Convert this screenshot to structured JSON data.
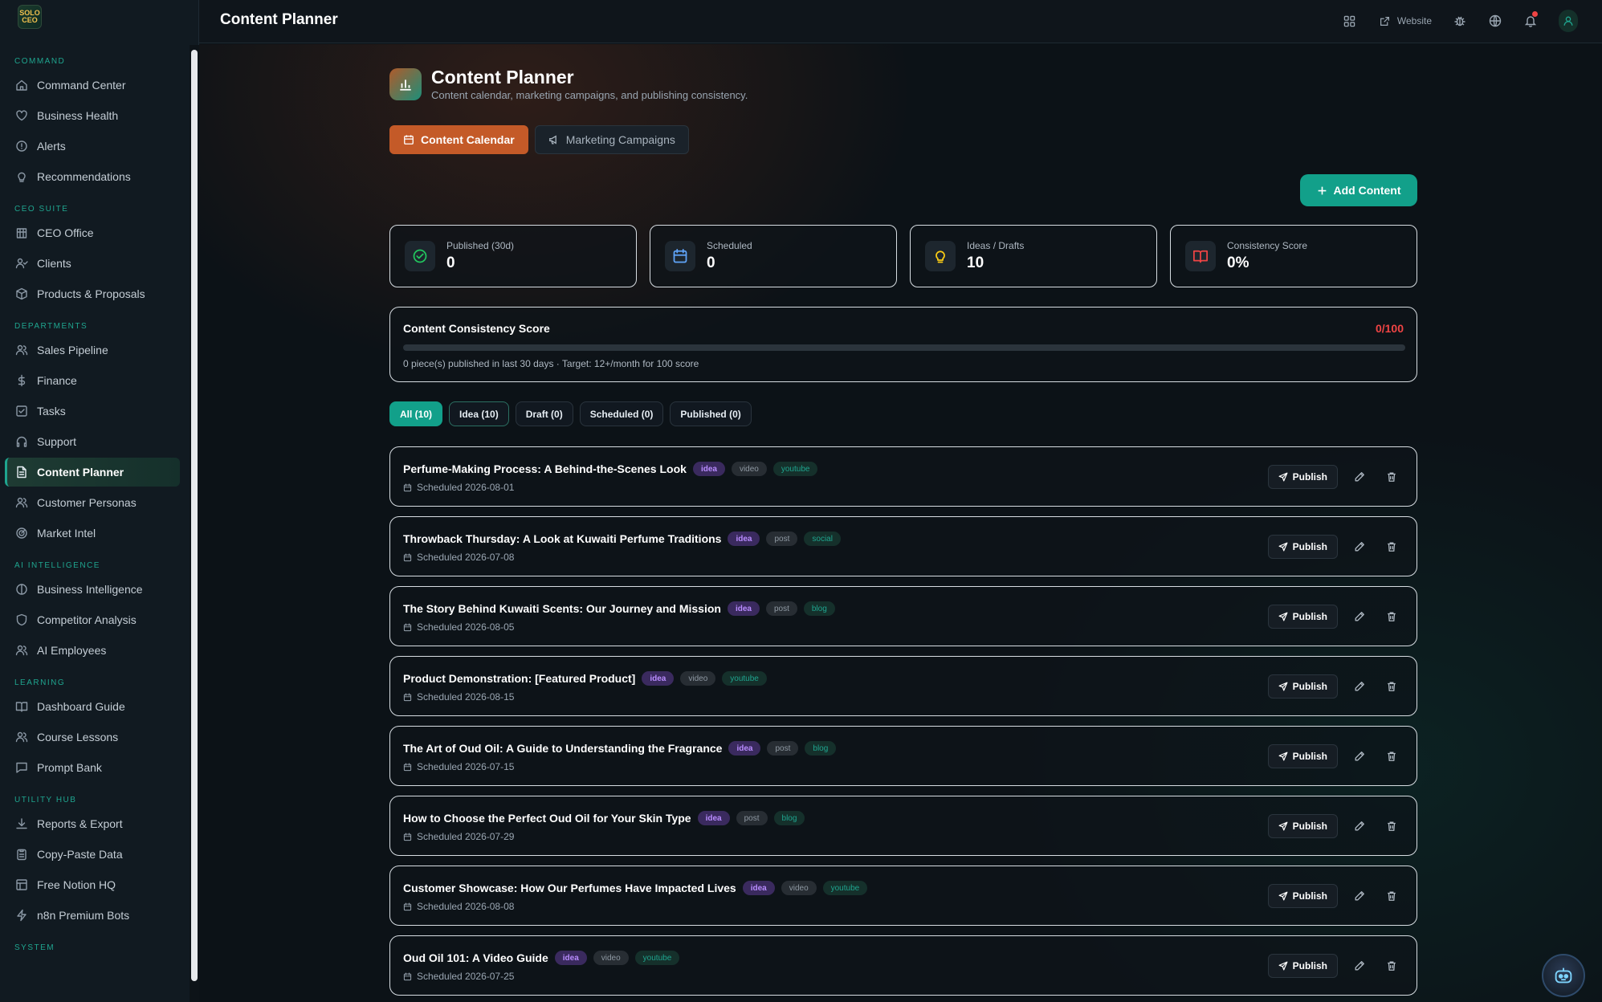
{
  "app": {
    "logo_text": "SOLO CEO",
    "topbar_title": "Content Planner"
  },
  "topbar": {
    "website_label": "Website"
  },
  "sidebar": {
    "sections": [
      {
        "label": "COMMAND",
        "items": [
          {
            "label": "Command Center",
            "icon": "home-icon"
          },
          {
            "label": "Business Health",
            "icon": "heart-icon"
          },
          {
            "label": "Alerts",
            "icon": "alert-circle-icon"
          },
          {
            "label": "Recommendations",
            "icon": "lightbulb-icon"
          }
        ]
      },
      {
        "label": "CEO SUITE",
        "items": [
          {
            "label": "CEO Office",
            "icon": "building-icon"
          },
          {
            "label": "Clients",
            "icon": "user-check-icon"
          },
          {
            "label": "Products & Proposals",
            "icon": "package-icon"
          }
        ]
      },
      {
        "label": "DEPARTMENTS",
        "items": [
          {
            "label": "Sales Pipeline",
            "icon": "users-icon"
          },
          {
            "label": "Finance",
            "icon": "dollar-icon"
          },
          {
            "label": "Tasks",
            "icon": "checkbox-icon"
          },
          {
            "label": "Support",
            "icon": "headphones-icon"
          },
          {
            "label": "Content Planner",
            "icon": "file-text-icon",
            "active": true
          },
          {
            "label": "Customer Personas",
            "icon": "users-icon"
          },
          {
            "label": "Market Intel",
            "icon": "radar-icon"
          }
        ]
      },
      {
        "label": "AI INTELLIGENCE",
        "items": [
          {
            "label": "Business Intelligence",
            "icon": "brain-icon"
          },
          {
            "label": "Competitor Analysis",
            "icon": "shield-icon"
          },
          {
            "label": "AI Employees",
            "icon": "users-icon"
          }
        ]
      },
      {
        "label": "LEARNING",
        "items": [
          {
            "label": "Dashboard Guide",
            "icon": "book-icon"
          },
          {
            "label": "Course Lessons",
            "icon": "users-icon"
          },
          {
            "label": "Prompt Bank",
            "icon": "message-icon"
          }
        ]
      },
      {
        "label": "UTILITY HUB",
        "items": [
          {
            "label": "Reports & Export",
            "icon": "download-icon"
          },
          {
            "label": "Copy-Paste Data",
            "icon": "clipboard-icon"
          },
          {
            "label": "Free Notion HQ",
            "icon": "layout-icon"
          },
          {
            "label": "n8n Premium Bots",
            "icon": "zap-icon"
          }
        ]
      },
      {
        "label": "SYSTEM",
        "items": []
      }
    ]
  },
  "page": {
    "title": "Content Planner",
    "subtitle": "Content calendar, marketing campaigns, and publishing consistency.",
    "tabs": [
      {
        "label": "Content Calendar",
        "active": true
      },
      {
        "label": "Marketing Campaigns",
        "active": false
      }
    ],
    "add_button": "Add Content"
  },
  "stats": [
    {
      "label": "Published (30d)",
      "value": "0",
      "icon": "check-circle-icon",
      "color": "#22c55e"
    },
    {
      "label": "Scheduled",
      "value": "0",
      "icon": "calendar-icon",
      "color": "#60a5fa"
    },
    {
      "label": "Ideas / Drafts",
      "value": "10",
      "icon": "lightbulb-icon",
      "color": "#facc15"
    },
    {
      "label": "Consistency Score",
      "value": "0%",
      "icon": "book-open-icon",
      "color": "#ef4444"
    }
  ],
  "score": {
    "title": "Content Consistency Score",
    "value": "0/100",
    "fraction": 0,
    "note": "0 piece(s) published in last 30 days · Target: 12+/month for 100 score"
  },
  "filters": [
    {
      "label": "All (10)",
      "state": "active"
    },
    {
      "label": "Idea (10)",
      "state": "outlined"
    },
    {
      "label": "Draft (0)",
      "state": ""
    },
    {
      "label": "Scheduled (0)",
      "state": ""
    },
    {
      "label": "Published (0)",
      "state": ""
    }
  ],
  "row_actions": {
    "publish_label": "Publish"
  },
  "content_items": [
    {
      "title": "Perfume-Making Process: A Behind-the-Scenes Look",
      "status": "idea",
      "kind": "video",
      "channel": "youtube",
      "date": "Scheduled 2026-08-01"
    },
    {
      "title": "Throwback Thursday: A Look at Kuwaiti Perfume Traditions",
      "status": "idea",
      "kind": "post",
      "channel": "social",
      "date": "Scheduled 2026-07-08"
    },
    {
      "title": "The Story Behind Kuwaiti Scents: Our Journey and Mission",
      "status": "idea",
      "kind": "post",
      "channel": "blog",
      "date": "Scheduled 2026-08-05"
    },
    {
      "title": "Product Demonstration: [Featured Product]",
      "status": "idea",
      "kind": "video",
      "channel": "youtube",
      "date": "Scheduled 2026-08-15"
    },
    {
      "title": "The Art of Oud Oil: A Guide to Understanding the Fragrance",
      "status": "idea",
      "kind": "post",
      "channel": "blog",
      "date": "Scheduled 2026-07-15"
    },
    {
      "title": "How to Choose the Perfect Oud Oil for Your Skin Type",
      "status": "idea",
      "kind": "post",
      "channel": "blog",
      "date": "Scheduled 2026-07-29"
    },
    {
      "title": "Customer Showcase: How Our Perfumes Have Impacted Lives",
      "status": "idea",
      "kind": "video",
      "channel": "youtube",
      "date": "Scheduled 2026-08-08"
    },
    {
      "title": "Oud Oil 101: A Video Guide",
      "status": "idea",
      "kind": "video",
      "channel": "youtube",
      "date": "Scheduled 2026-07-25"
    }
  ]
}
